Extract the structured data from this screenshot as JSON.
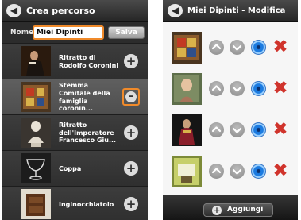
{
  "left_screen": {
    "title": "Crea percorso",
    "name_label": "Nome:",
    "name_value": "Miei Dipinti",
    "save_label": "Salva",
    "items": [
      {
        "label": "Ritratto di Rodolfo Coronini",
        "action": "add"
      },
      {
        "label": "Stemma Comitale della famiglia coronin...",
        "action": "remove",
        "selected": true
      },
      {
        "label": "Ritratto dell'Imperatore Francesco Giu...",
        "action": "add"
      },
      {
        "label": "Coppa",
        "action": "add"
      },
      {
        "label": "Inginocchiatoio",
        "action": "add"
      }
    ],
    "add_symbol": "+",
    "remove_symbol": "–"
  },
  "right_screen": {
    "title": "Miei Dipinti - Modifica",
    "rows": [
      {
        "thumb": "painting-thumbnail-1"
      },
      {
        "thumb": "painting-thumbnail-2"
      },
      {
        "thumb": "painting-thumbnail-3"
      },
      {
        "thumb": "painting-thumbnail-4"
      }
    ],
    "add_button_label": "Aggiungi",
    "add_button_symbol": "+"
  },
  "icons": {
    "back": "back-arrow-icon",
    "move_up": "move-up-icon",
    "move_down": "move-down-icon",
    "view": "eye-icon",
    "delete": "delete-x-icon"
  },
  "colors": {
    "highlight": "#f08a2a",
    "delete": "#d0342c",
    "eye": "#1c7be0"
  }
}
